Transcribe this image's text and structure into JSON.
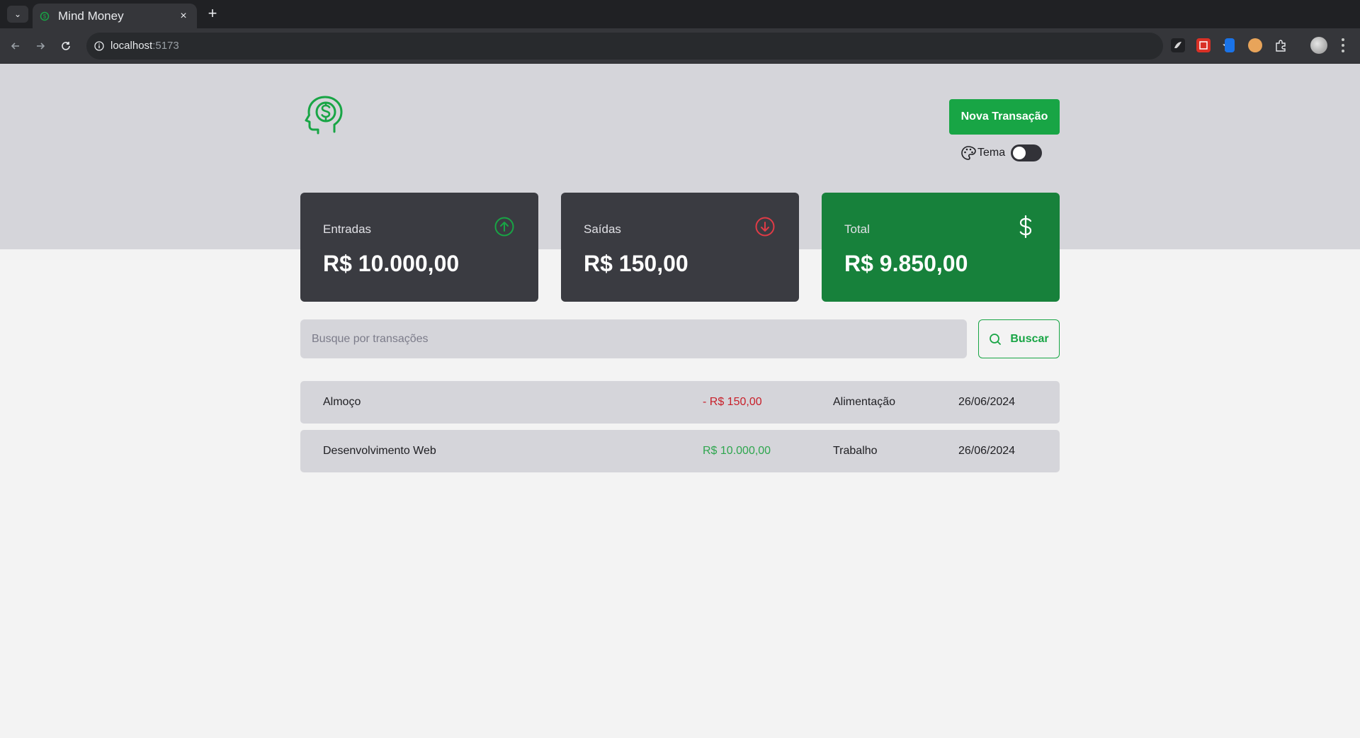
{
  "browser": {
    "tab_title": "Mind Money",
    "tab_close": "×",
    "new_tab": "+",
    "tab_list": "⌄",
    "url_host": "localhost",
    "url_port": ":5173"
  },
  "app": {
    "new_transaction_label": "Nova Transação",
    "theme_label": "Tema",
    "theme_dark_enabled": false,
    "colors": {
      "brand": "#18a545",
      "income": "#2ea64e",
      "outcome": "#c8202a",
      "card": "#3a3b41",
      "total_card": "#17813b"
    }
  },
  "summary": {
    "income": {
      "label": "Entradas",
      "value": "R$ 10.000,00",
      "icon": "arrow-circle-up-icon"
    },
    "outcome": {
      "label": "Saídas",
      "value": "R$ 150,00",
      "icon": "arrow-circle-down-icon"
    },
    "total": {
      "label": "Total",
      "value": "R$ 9.850,00",
      "icon": "dollar-icon"
    }
  },
  "search": {
    "placeholder": "Busque por transações",
    "button_label": "Buscar"
  },
  "transactions": [
    {
      "description": "Almoço",
      "amount": "- R$ 150,00",
      "type": "outcome",
      "category": "Alimentação",
      "date": "26/06/2024"
    },
    {
      "description": "Desenvolvimento Web",
      "amount": "R$ 10.000,00",
      "type": "income",
      "category": "Trabalho",
      "date": "26/06/2024"
    }
  ]
}
